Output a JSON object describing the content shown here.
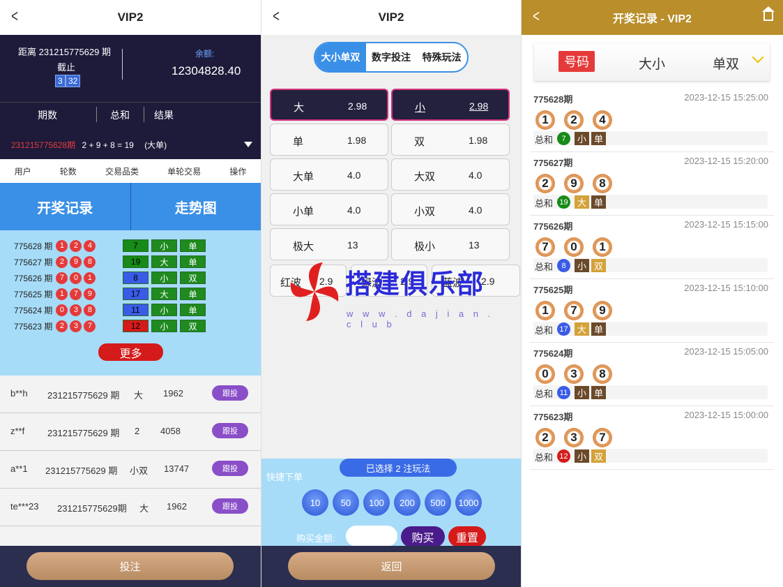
{
  "panel1": {
    "title": "VIP2",
    "countdown_label": "距离 231215775629 期",
    "countdown_sub": "截止",
    "countdown_min": "3",
    "countdown_sec": "32",
    "balance_label": "余额:",
    "balance": "12304828.40",
    "hist_headers": [
      "期数",
      "总和",
      "结果"
    ],
    "last_period": "231215775628期",
    "last_formula": "2 + 9 + 8 = 19",
    "last_result": "(大单)",
    "cols": [
      "用户",
      "轮数",
      "交易品类",
      "单轮交易",
      "操作"
    ],
    "btn_records": "开奖记录",
    "btn_trend": "走势图",
    "results": [
      {
        "period": "775628 期",
        "balls": [
          "1",
          "2",
          "4"
        ],
        "sum": "7",
        "size": "小",
        "parity": "单",
        "sum_color": "#178a17"
      },
      {
        "period": "775627 期",
        "balls": [
          "2",
          "9",
          "8"
        ],
        "sum": "19",
        "size": "大",
        "parity": "单",
        "sum_color": "#178a17"
      },
      {
        "period": "775626 期",
        "balls": [
          "7",
          "0",
          "1"
        ],
        "sum": "8",
        "size": "小",
        "parity": "双",
        "sum_color": "#3a5be6"
      },
      {
        "period": "775625 期",
        "balls": [
          "1",
          "7",
          "9"
        ],
        "sum": "17",
        "size": "大",
        "parity": "单",
        "sum_color": "#3a5be6"
      },
      {
        "period": "775624 期",
        "balls": [
          "0",
          "3",
          "8"
        ],
        "sum": "11",
        "size": "小",
        "parity": "单",
        "sum_color": "#3a5be6"
      },
      {
        "period": "775623 期",
        "balls": [
          "2",
          "3",
          "7"
        ],
        "sum": "12",
        "size": "小",
        "parity": "双",
        "sum_color": "#d51a1a"
      }
    ],
    "more": "更多",
    "bets": [
      {
        "user": "b**h",
        "round": "231215775629 期",
        "type": "大",
        "amount": "1962",
        "action": "跟投"
      },
      {
        "user": "z**f",
        "round": "231215775629 期",
        "type": "2",
        "amount": "4058",
        "action": "跟投"
      },
      {
        "user": "a**1",
        "round": "231215775629 期",
        "type": "小双",
        "amount": "13747",
        "action": "跟投"
      },
      {
        "user": "te***23",
        "round": "231215775629期",
        "type": "大",
        "amount": "1962",
        "action": "跟投"
      }
    ],
    "submit": "投注"
  },
  "panel2": {
    "title": "VIP2",
    "tabs": [
      "大小单双",
      "数字投注",
      "特殊玩法"
    ],
    "options": [
      {
        "name": "大",
        "odds": "2.98"
      },
      {
        "name": "小",
        "odds": "2.98"
      },
      {
        "name": "单",
        "odds": "1.98"
      },
      {
        "name": "双",
        "odds": "1.98"
      },
      {
        "name": "大单",
        "odds": "4.0"
      },
      {
        "name": "大双",
        "odds": "4.0"
      },
      {
        "name": "小单",
        "odds": "4.0"
      },
      {
        "name": "小双",
        "odds": "4.0"
      },
      {
        "name": "极大",
        "odds": "13"
      },
      {
        "name": "极小",
        "odds": "13"
      },
      {
        "name": "红波",
        "odds": "2.9"
      },
      {
        "name": "绿波",
        "odds": "2.9"
      },
      {
        "name": "蓝波",
        "odds": "2.9"
      }
    ],
    "selected_info": "已选择 2 注玩法",
    "quick_label": "快捷下单",
    "chips": [
      "10",
      "50",
      "100",
      "200",
      "500",
      "1000"
    ],
    "amount_label": "购买金额:",
    "buy": "购买",
    "reset": "重置",
    "back": "返回",
    "watermark": "搭建俱乐部",
    "watermark_url": "w w w . d a j i a n . c l u b"
  },
  "panel3": {
    "title": "开奖记录 - VIP2",
    "filters": [
      "号码",
      "大小",
      "单双"
    ],
    "sum_label": "总和",
    "draws": [
      {
        "id": "775628期",
        "time": "2023-12-15 15:25:00",
        "balls": [
          "1",
          "2",
          "4"
        ],
        "sum": "7",
        "sum_color": "#178a17",
        "size": "小",
        "parity": "单"
      },
      {
        "id": "775627期",
        "time": "2023-12-15 15:20:00",
        "balls": [
          "2",
          "9",
          "8"
        ],
        "sum": "19",
        "sum_color": "#178a17",
        "size": "大",
        "parity": "单"
      },
      {
        "id": "775626期",
        "time": "2023-12-15 15:15:00",
        "balls": [
          "7",
          "0",
          "1"
        ],
        "sum": "8",
        "sum_color": "#3a5be6",
        "size": "小",
        "parity": "双"
      },
      {
        "id": "775625期",
        "time": "2023-12-15 15:10:00",
        "balls": [
          "1",
          "7",
          "9"
        ],
        "sum": "17",
        "sum_color": "#3a5be6",
        "size": "大",
        "parity": "单"
      },
      {
        "id": "775624期",
        "time": "2023-12-15 15:05:00",
        "balls": [
          "0",
          "3",
          "8"
        ],
        "sum": "11",
        "sum_color": "#3a5be6",
        "size": "小",
        "parity": "单"
      },
      {
        "id": "775623期",
        "time": "2023-12-15 15:00:00",
        "balls": [
          "2",
          "3",
          "7"
        ],
        "sum": "12",
        "sum_color": "#d51a1a",
        "size": "小",
        "parity": "双"
      }
    ]
  },
  "colors": {
    "navy": "#1d1a3a",
    "blue": "#3a8fe6",
    "gold": "#b98e2b",
    "red": "#d51a1a",
    "size_big": "#d4a23a",
    "size_small": "#6b4a2a"
  }
}
